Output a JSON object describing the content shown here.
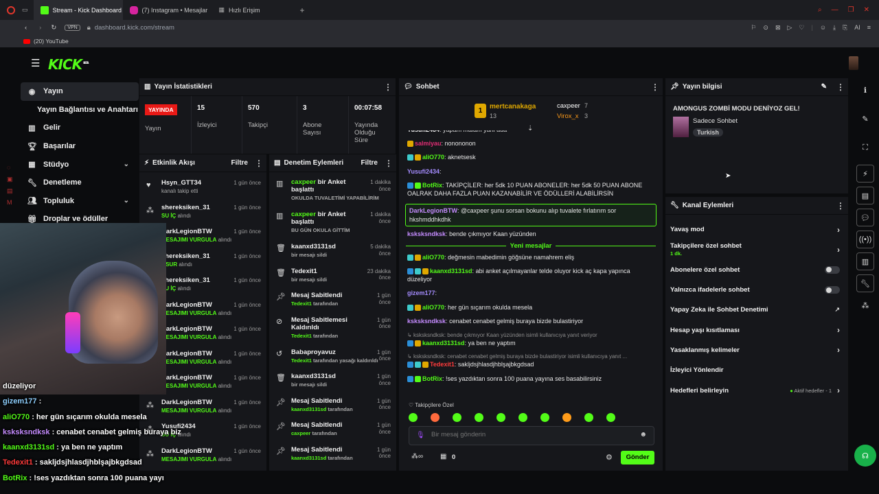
{
  "browser": {
    "tabs": [
      {
        "label": "Stream - Kick Dashboard",
        "color": "#53fc18",
        "active": true
      },
      {
        "label": "(7) Instagram • Mesajlar",
        "color": "#d6249f",
        "active": false
      },
      {
        "label": "Hızlı Erişim",
        "color": "#5a5f6a",
        "active": false
      }
    ],
    "address": "dashboard.kick.com/stream",
    "vpn": "VPN",
    "bookmark": "(20) YouTube",
    "ai_label": "AI"
  },
  "site": {
    "logo": "KICK",
    "logo_beta": "BETA"
  },
  "sidebar": {
    "items": [
      {
        "label": "Yayın",
        "icon": "broadcast-icon",
        "active": true
      },
      {
        "label": "Yayın Bağlantısı ve Anahtarı",
        "icon": "",
        "active": false
      },
      {
        "label": "Gelir",
        "icon": "chart-icon",
        "active": false
      },
      {
        "label": "Başarılar",
        "icon": "trophy-icon",
        "active": false
      },
      {
        "label": "Stüdyo",
        "icon": "studio-icon",
        "active": false,
        "expandable": true
      },
      {
        "label": "Denetleme",
        "icon": "wrench-icon",
        "active": false
      },
      {
        "label": "Topluluk",
        "icon": "community-icon",
        "active": false,
        "expandable": true
      },
      {
        "label": "Droplar ve ödüller",
        "icon": "gift-icon",
        "active": false
      }
    ]
  },
  "stats": {
    "title": "Yayın İstatistikleri",
    "live_badge": "YAYINDA",
    "live_label": "Yayın",
    "viewers": {
      "value": "15",
      "label": "İzleyici"
    },
    "followers": {
      "value": "570",
      "label": "Takipçi"
    },
    "subs": {
      "value": "3",
      "label": "Abone Sayısı"
    },
    "uptime": {
      "value": "00:07:58",
      "label": "Yayında Olduğu Süre"
    }
  },
  "activity": {
    "title": "Etkinlik Akışı",
    "filter": "Filtre",
    "rows": [
      {
        "name": "Hsyn_GTT34",
        "sub": "kanalı takip etti",
        "highlight": "",
        "time": "1 gün önce",
        "icon": "heart-icon"
      },
      {
        "name": "shereksiken_31",
        "sub": "alındı",
        "highlight": "SU İÇ",
        "time": "1 gün önce",
        "icon": "points-icon"
      },
      {
        "name": "DarkLegionBTW",
        "sub": "alındı",
        "highlight": "MESAJIMI VURGULA",
        "time": "1 gün önce",
        "icon": "points-icon"
      },
      {
        "name": "shereksiken_31",
        "sub": "alındı",
        "highlight": "OSUR",
        "time": "1 gün önce",
        "icon": "points-icon"
      },
      {
        "name": "shereksiken_31",
        "sub": "alındı",
        "highlight": "SU İÇ",
        "time": "1 gün önce",
        "icon": "points-icon"
      },
      {
        "name": "DarkLegionBTW",
        "sub": "alındı",
        "highlight": "MESAJIMI VURGULA",
        "time": "1 gün önce",
        "icon": "points-icon"
      },
      {
        "name": "DarkLegionBTW",
        "sub": "alındı",
        "highlight": "MESAJIMI VURGULA",
        "time": "1 gün önce",
        "icon": "points-icon"
      },
      {
        "name": "DarkLegionBTW",
        "sub": "alındı",
        "highlight": "MESAJIMI VURGULA",
        "time": "1 gün önce",
        "icon": "points-icon"
      },
      {
        "name": "DarkLegionBTW",
        "sub": "alındı",
        "highlight": "MESAJIMI VURGULA",
        "time": "1 gün önce",
        "icon": "points-icon"
      },
      {
        "name": "DarkLegionBTW",
        "sub": "alındı",
        "highlight": "MESAJIMI VURGULA",
        "time": "1 gün önce",
        "icon": "points-icon"
      },
      {
        "name": "Yusufi2434",
        "sub": "alındı",
        "highlight": "SU İÇ",
        "time": "1 gün önce",
        "icon": "points-icon"
      },
      {
        "name": "DarkLegionBTW",
        "sub": "alındı",
        "highlight": "MESAJIMI VURGULA",
        "time": "1 gün önce",
        "icon": "points-icon"
      }
    ]
  },
  "moderation": {
    "title": "Denetim Eylemleri",
    "filter": "Filtre",
    "rows": [
      {
        "user": "caxpeer",
        "action": "bir Anket başlattı",
        "sub": "OKULDA TUVALETİMİ YAPABİLİRİM",
        "subuser": "",
        "time": "1 dakika önce",
        "icon": "poll-icon",
        "h": 47
      },
      {
        "user": "caxpeer",
        "action": "bir Anket başlattı",
        "sub": "BU GÜN OKULA GİTTİM",
        "subuser": "",
        "time": "1 dakika önce",
        "icon": "poll-icon",
        "h": 47
      },
      {
        "user": "",
        "action": "kaanxd3131sd",
        "sub": "bir mesajı sildi",
        "subuser": "",
        "time": "5 dakika önce",
        "icon": "trash-icon",
        "h": 35.5
      },
      {
        "user": "",
        "action": "Tedexit1",
        "sub": "bir mesajı sildi",
        "subuser": "",
        "time": "23 dakika önce",
        "icon": "trash-icon",
        "h": 35.5
      },
      {
        "user": "",
        "action": "Mesaj Sabitlendi",
        "sub": "tarafından",
        "subuser": "Tedexit1",
        "time": "1 gün önce",
        "icon": "pin-icon",
        "h": 35.5
      },
      {
        "user": "",
        "action": "Mesaj Sabitlemesi Kaldırıldı",
        "sub": "tarafından",
        "subuser": "Tedexit1",
        "time": "1 gün önce",
        "icon": "unpin-icon",
        "h": 47
      },
      {
        "user": "",
        "action": "Babaproyavuz",
        "sub": "tarafından yasağı kaldırıldı",
        "subuser": "Tedexit1",
        "time": "1 gün önce",
        "icon": "unban-icon",
        "h": 35.5
      },
      {
        "user": "",
        "action": "kaanxd3131sd",
        "sub": "bir mesajı sildi",
        "subuser": "",
        "time": "1 gün önce",
        "icon": "trash-icon",
        "h": 35.5
      },
      {
        "user": "",
        "action": "Mesaj Sabitlendi",
        "sub": "tarafından",
        "subuser": "kaanxd3131sd",
        "time": "1 gün önce",
        "icon": "pin-icon",
        "h": 35.5
      },
      {
        "user": "",
        "action": "Mesaj Sabitlendi",
        "sub": "tarafından",
        "subuser": "caxpeer",
        "time": "1 gün önce",
        "icon": "pin-icon",
        "h": 35.5
      },
      {
        "user": "",
        "action": "Mesaj Sabitlendi",
        "sub": "tarafından",
        "subuser": "kaanxd3131sd",
        "time": "1 gün önce",
        "icon": "pin-icon",
        "h": 35.5
      }
    ]
  },
  "chat": {
    "title": "Sohbet",
    "top_user": {
      "name": "mertcanakaga",
      "count": "13"
    },
    "top_others": [
      {
        "name": "caxpeer",
        "count": "7",
        "color": "#ffffff"
      },
      {
        "name": "Virox_x",
        "count": "3",
        "color": "#ff9c1a"
      }
    ],
    "messages": [
      {
        "user": "Yusufi2434",
        "color": "#ffffff",
        "text": "yapam malam yani aua",
        "badges": [],
        "partial": true
      },
      {
        "user": "salmiyau",
        "color": "#e22d75",
        "text": "nonononon",
        "badges": [
          "#e0a800"
        ]
      },
      {
        "user": "aliO770",
        "color": "#53fc18",
        "text": "aknetsesk",
        "badges": [
          "#3ecbcb",
          "#e0a800"
        ]
      },
      {
        "user": "Yusufi2434",
        "color": "#a58cff",
        "text": "",
        "badges": []
      },
      {
        "user": "BotRix",
        "color": "#53fc18",
        "text": "TAKİPÇİLER: her 5dk 10 PUAN ABONELER: her 5dk 50 PUAN ABONE OALRAK DAHA FAZLA PUAN KAZANABİLİR VE ÖDÜLLERİ ALABİLİRSİN",
        "badges": [
          "#2b8fd8",
          "#53fc18"
        ]
      }
    ],
    "highlight": {
      "user": "DarkLegionBTW",
      "text": "@caxpeer şunu sorsan bokunu alıp tuvalete fırlatırım sor hkshmddhkdhk"
    },
    "after_highlight": {
      "user": "ksksksndksk",
      "color": "#c58cff",
      "text": "bende çıkmıyor Kaan yüzünden"
    },
    "new_messages": "Yeni mesajlar",
    "new": [
      {
        "user": "aliO770",
        "color": "#53fc18",
        "text": "değmesin mabedimin göğsüne namahrem eliş",
        "badges": [
          "#3ecbcb",
          "#e0a800"
        ]
      },
      {
        "user": "kaanxd3131sd",
        "color": "#53fc18",
        "text": "abi anket açılmayanlar telde oluyor kick aç kapa yapınca düzeliyor",
        "badges": [
          "#2b8fd8",
          "#3ecbcb",
          "#e0a800"
        ]
      },
      {
        "user": "gizem177",
        "color": "#a58cff",
        "text": "",
        "badges": []
      },
      {
        "user": "aliO770",
        "color": "#53fc18",
        "text": "her gün sıçarım okulda mesela",
        "badges": [
          "#3ecbcb",
          "#e0a800"
        ]
      },
      {
        "user": "ksksksndksk",
        "color": "#c58cff",
        "text": "cenabet cenabet gelmiş buraya bizde bulastiriyor",
        "badges": []
      }
    ],
    "reply1": "ksksksndksk: bende çıkmıyor Kaan yüzünden isimli kullanıcıya yanıt veriyor",
    "reply1_msg": {
      "user": "kaanxd3131sd",
      "color": "#53fc18",
      "text": "ya ben ne yaptım"
    },
    "reply2": "ksksksndksk: cenabet cenabet gelmiş buraya bizde bulastiriyor isimli kullanıcıya yanıt ...",
    "reply2_msg": {
      "user": "Tedexit1",
      "color": "#ff3b3b",
      "text": "sakljdsjhlasdjhblşajbkgdsad"
    },
    "last_msg": {
      "user": "BotRix",
      "color": "#53fc18",
      "text": "!ses yazdıktan sonra 100 puana yayına ses basabilirsiniz"
    },
    "followers_only": "Takipçilere Özel",
    "input_placeholder": "Bir mesaj gönderin",
    "points": "0",
    "send": "Gönder"
  },
  "stream_info": {
    "title_label": "Yayın bilgisi",
    "title": "AMONGUS ZOMBİ MODU DENİYOZ GEL!",
    "category": "Sadece Sohbet",
    "tag": "Turkish"
  },
  "channel_actions": {
    "title": "Kanal Eylemleri",
    "items": [
      {
        "label": "Yavaş mod",
        "sub": "",
        "kind": "chevron"
      },
      {
        "label": "Takipçilere özel sohbet",
        "sub": "1 dk.",
        "kind": "chevron"
      },
      {
        "label": "Abonelere özel sohbet",
        "sub": "",
        "kind": "toggle"
      },
      {
        "label": "Yalnızca ifadelerle sohbet",
        "sub": "",
        "kind": "toggle"
      },
      {
        "label": "Yapay Zeka ile Sohbet Denetimi",
        "sub": "",
        "kind": "external"
      },
      {
        "label": "Hesap yaşı kısıtlaması",
        "sub": "",
        "kind": "chevron"
      },
      {
        "label": "Yasaklanmış kelimeler",
        "sub": "",
        "kind": "chevron"
      },
      {
        "label": "İzleyici Yönlendir",
        "sub": "",
        "kind": "none"
      },
      {
        "label": "Hedefleri belirleyin",
        "sub": "",
        "kind": "goals",
        "extra": "Aktif hedefler - 1"
      }
    ]
  },
  "overlay_chat": [
    {
      "user": "",
      "text": "düzeliyor",
      "color": "#ffffff"
    },
    {
      "user": "gizem177",
      "text": ":",
      "color": "#8fd0ff"
    },
    {
      "user": "aliO770",
      "text": ": her gün sıçarım okulda mesela",
      "color": "#53fc18"
    },
    {
      "user": "ksksksndksk",
      "text": ": cenabet cenabet gelmiş buraya biz",
      "color": "#c58cff"
    },
    {
      "user": "kaanxd3131sd",
      "text": ": ya ben ne yaptım",
      "color": "#53fc18"
    },
    {
      "user": "Tedexit1",
      "text": ": sakljdsjhlasdjhblşajbkgdsad",
      "color": "#ff3b3b"
    },
    {
      "user": "BotRix",
      "text": ": !ses yazdıktan sonra 100 puana yayı",
      "color": "#53fc18"
    }
  ],
  "colors": {
    "accent": "#53fc18",
    "live": "#e91916",
    "panel": "#16171b",
    "bg": "#0b0c0e"
  }
}
